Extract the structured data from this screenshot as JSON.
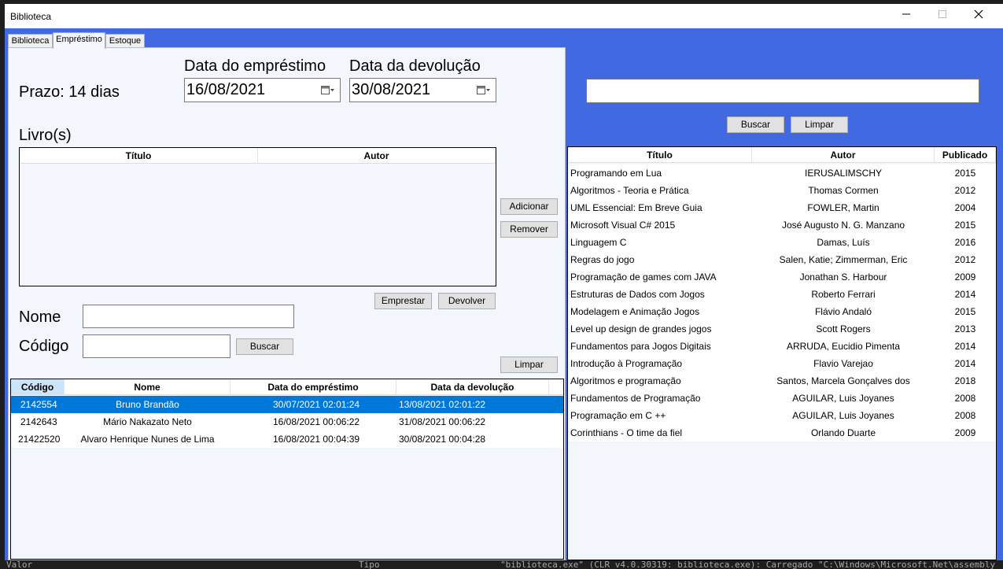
{
  "window": {
    "title": "Biblioteca"
  },
  "tabs": [
    {
      "label": "Biblioteca"
    },
    {
      "label": "Empréstimo"
    },
    {
      "label": "Estoque"
    }
  ],
  "loan": {
    "prazo_label": "Prazo: 14 dias",
    "loan_date_label": "Data do empréstimo",
    "loan_date_value": "16/08/2021",
    "return_date_label": "Data da devolução",
    "return_date_value": "30/08/2021",
    "books_label": "Livro(s)",
    "books_columns": [
      "Título",
      "Autor"
    ],
    "add_button": "Adicionar",
    "remove_button": "Remover",
    "lend_button": "Emprestar",
    "return_button": "Devolver",
    "name_label": "Nome",
    "code_label": "Código",
    "search_button": "Buscar",
    "clear_button": "Limpar"
  },
  "loans_table": {
    "columns": [
      "Código",
      "Nome",
      "Data do empréstimo",
      "Data da devolução"
    ],
    "rows": [
      {
        "code": "2142554",
        "name": "Bruno Brandão",
        "loan_date": "30/07/2021 02:01:24",
        "return_date": "13/08/2021 02:01:22",
        "selected": true
      },
      {
        "code": "2142643",
        "name": "Mário Nakazato Neto",
        "loan_date": "16/08/2021 00:06:22",
        "return_date": "31/08/2021 00:06:22",
        "selected": false
      },
      {
        "code": "21422520",
        "name": "Alvaro Henrique Nunes de Lima",
        "loan_date": "16/08/2021 00:04:39",
        "return_date": "30/08/2021 00:04:28",
        "selected": false
      }
    ]
  },
  "catalog": {
    "search_value": "",
    "search_button": "Buscar",
    "clear_button": "Limpar",
    "columns": [
      "Título",
      "Autor",
      "Publicado"
    ],
    "rows": [
      {
        "title": "Programando em Lua",
        "author": "IERUSALIMSCHY",
        "year": "2015"
      },
      {
        "title": "Algoritmos - Teoria e Prática",
        "author": "Thomas Cormen",
        "year": "2012"
      },
      {
        "title": "UML Essencial: Em Breve Guia",
        "author": "FOWLER, Martin",
        "year": "2004"
      },
      {
        "title": "Microsoft Visual C# 2015",
        "author": "José Augusto N. G. Manzano",
        "year": "2015"
      },
      {
        "title": "Linguagem C",
        "author": "Damas, Luís",
        "year": "2016"
      },
      {
        "title": "Regras do jogo",
        "author": "Salen, Katie; Zimmerman, Eric",
        "year": "2012"
      },
      {
        "title": "Programação de games com JAVA",
        "author": "Jonathan S. Harbour",
        "year": "2009"
      },
      {
        "title": "Estruturas de Dados com Jogos",
        "author": "Roberto Ferrari",
        "year": "2014"
      },
      {
        "title": "Modelagem e Animação Jogos",
        "author": "Flávio Andaló",
        "year": "2015"
      },
      {
        "title": "Level up design de grandes jogos",
        "author": "Scott Rogers",
        "year": "2013"
      },
      {
        "title": "Fundamentos para Jogos Digitais",
        "author": "ARRUDA, Eucidio Pimenta",
        "year": "2014"
      },
      {
        "title": "Introdução à Programação",
        "author": "Flavio Varejao",
        "year": "2014"
      },
      {
        "title": "Algoritmos e programação",
        "author": "Santos, Marcela Gonçalves dos",
        "year": "2018"
      },
      {
        "title": "Fundamentos de Programação",
        "author": "AGUILAR, Luis Joyanes",
        "year": "2008"
      },
      {
        "title": "Programação em C ++",
        "author": "AGUILAR, Luis Joyanes",
        "year": "2008"
      },
      {
        "title": "Corinthians - O time da fiel",
        "author": "Orlando Duarte",
        "year": "2009"
      }
    ]
  },
  "background_console": {
    "left_text": "Valor",
    "mid_text": "Tipo",
    "right_text": "\"biblioteca.exe\" (CLR v4.0.30319: biblioteca.exe): Carregado \"C:\\Windows\\Microsoft.Net\\assembly"
  },
  "colors": {
    "accent": "#4169e1",
    "selection": "#0078d7",
    "panel": "#f4f6fd"
  },
  "icons": {
    "minimize": "minimize-icon",
    "maximize": "maximize-icon",
    "close": "close-icon",
    "calendar": "calendar-dropdown-icon"
  }
}
